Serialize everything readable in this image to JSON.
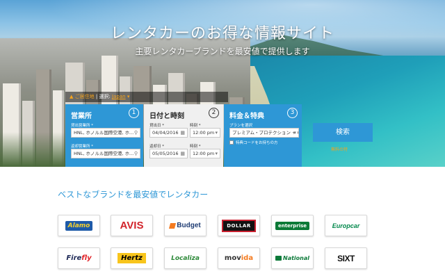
{
  "hero": {
    "title": "レンタカーのお得な情報サイト",
    "subtitle": "主要レンタカーブランドを最安値で提供します"
  },
  "residence": {
    "marker": "▲",
    "label": "ご居住地",
    "separator": "|",
    "select_text": "選択:",
    "country": "Japan",
    "dropdown": "▾"
  },
  "panels": {
    "location": {
      "title": "営業所",
      "step": "1",
      "pickup_label": "貸出営業所 *",
      "pickup_value": "HNL, ホノルル国際空港, ホ...",
      "return_label": "返却営業所 *",
      "return_value": "HNL, ホノルル国際空港, ホ..."
    },
    "datetime": {
      "title": "日付と時刻",
      "step": "2",
      "pickup_date_label": "貸出日 *",
      "pickup_date": "04/04/2016",
      "pickup_time_label": "時刻 *",
      "pickup_time": "12:00 pm",
      "return_date_label": "返却日 *",
      "return_date": "05/05/2016",
      "return_time_label": "時刻 *",
      "return_time": "12:00 pm"
    },
    "rate": {
      "title": "料金＆特典",
      "step": "3",
      "plan_label": "プランを選択",
      "plan_value": "プレミアム・プロテクション + GPS",
      "promo_text": "特典コードをお持ちの方"
    }
  },
  "search": {
    "button_label": "検索",
    "note": "無料の特"
  },
  "brands": {
    "title": "ベストなブランドを最安値でレンタカー",
    "items": [
      {
        "id": "alamo",
        "label": "Alamo"
      },
      {
        "id": "avis",
        "label": "AVIS"
      },
      {
        "id": "budget",
        "label": "Budget"
      },
      {
        "id": "dollar",
        "label": "DOLLAR"
      },
      {
        "id": "enterprise",
        "label": "enterprise"
      },
      {
        "id": "europcar",
        "label": "Europcar"
      },
      {
        "id": "firefly",
        "label": "Firefly",
        "prefix": "Fire",
        "suffix": "fly"
      },
      {
        "id": "hertz",
        "label": "Hertz"
      },
      {
        "id": "localiza",
        "label": "Localiza"
      },
      {
        "id": "movida",
        "label": "movida",
        "prefix": "mov",
        "suffix": "ida"
      },
      {
        "id": "national",
        "label": "National"
      },
      {
        "id": "sixt",
        "label": "SIXT"
      }
    ]
  },
  "icons": {
    "pin": "pin-icon",
    "calendar": "calendar-icon",
    "dropdown": "chevron-down-icon"
  }
}
